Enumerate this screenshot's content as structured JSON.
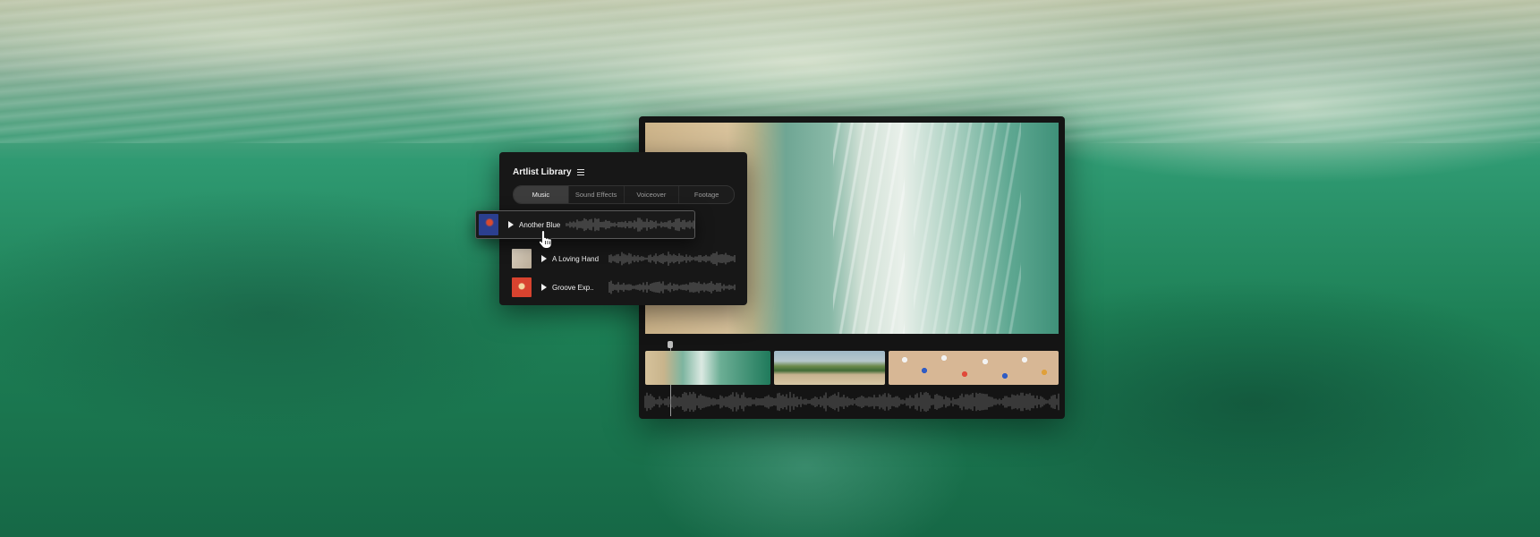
{
  "library": {
    "title": "Artlist Library",
    "tabs": [
      {
        "label": "Music",
        "active": true
      },
      {
        "label": "Sound Effects",
        "active": false
      },
      {
        "label": "Voiceover",
        "active": false
      },
      {
        "label": "Footage",
        "active": false
      }
    ],
    "tracks": [
      {
        "name": "Another Blue",
        "thumb_color": "#2b3f8f",
        "icon": "play-icon"
      },
      {
        "name": "A Loving Hand",
        "thumb_color": "#cfc3b1",
        "icon": "play-icon"
      },
      {
        "name": "Groove Exp..",
        "thumb_color": "#d8432f",
        "icon": "play-icon"
      }
    ]
  },
  "colors": {
    "panel_bg": "#171717",
    "editor_bg": "#141414",
    "active_tab": "#3c3c3c",
    "waveform": "#6a6a6a"
  }
}
